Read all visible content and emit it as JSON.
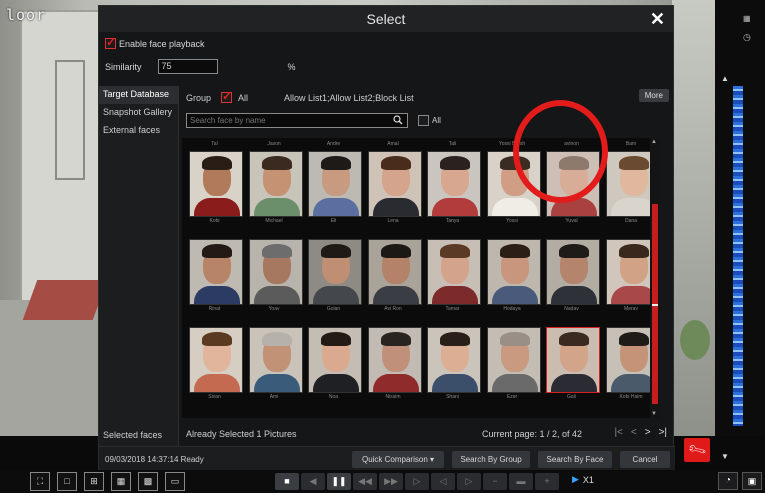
{
  "camera": {
    "label": "loor"
  },
  "dialog": {
    "title": "Select",
    "enable_face_playback": {
      "label": "Enable face playback",
      "checked": true
    },
    "similarity": {
      "label": "Similarity",
      "value": "75",
      "unit": "%"
    },
    "sidebar": {
      "items": [
        {
          "label": "Target Database",
          "active": true
        },
        {
          "label": "Snapshot Gallery",
          "active": false
        },
        {
          "label": "External faces",
          "active": false
        }
      ],
      "selected_faces": "Selected faces"
    },
    "group": {
      "label": "Group",
      "all_label": "All",
      "all_checked": true,
      "lists": "Allow List1;Allow List2;Block List",
      "more": "More"
    },
    "search": {
      "placeholder": "Search face by name",
      "all_label": "All"
    },
    "faces": [
      {
        "top": "Tal",
        "bottom": "Kobi",
        "skin": "#b17a5a",
        "hair": "#2a1d16",
        "body": "#8a1c1c",
        "bg": "#d9d2c9",
        "selected": false
      },
      {
        "top": "Jason",
        "bottom": "Michael",
        "skin": "#c59274",
        "hair": "#3a2a20",
        "body": "#6c8f6b",
        "bg": "#c8c4ba",
        "selected": false
      },
      {
        "top": "Andre",
        "bottom": "Eli",
        "skin": "#c89a80",
        "hair": "#1d1a18",
        "body": "#5a6fa0",
        "bg": "#bcbab3",
        "selected": false
      },
      {
        "top": "Amal",
        "bottom": "Lena",
        "skin": "#d4a48c",
        "hair": "#4a2c1c",
        "body": "#2a2b30",
        "bg": "#cfc3b8",
        "selected": false
      },
      {
        "top": "Tali",
        "bottom": "Tanya",
        "skin": "#d7a88f",
        "hair": "#2b2220",
        "body": "#b23b3b",
        "bg": "#cac6bf",
        "selected": false
      },
      {
        "top": "Yossi Brosh",
        "bottom": "Yossi",
        "skin": "#cf9e84",
        "hair": "#3a2c22",
        "body": "#f0ede6",
        "bg": "#d8d2c9",
        "selected": false
      },
      {
        "top": "avinon",
        "bottom": "Yuval",
        "skin": "#d7ad98",
        "hair": "#8d7a6c",
        "body": "#a94141",
        "bg": "#cdbfb6",
        "selected": false
      },
      {
        "top": "Bam",
        "bottom": "Dana",
        "skin": "#e0b89e",
        "hair": "#6a4a30",
        "body": "#d9d4cc",
        "bg": "#cfc8be",
        "selected": false
      },
      {
        "top": "",
        "bottom": "Rinat",
        "skin": "#b88468",
        "hair": "#241a15",
        "body": "#2c3b63",
        "bg": "#bfbab1",
        "selected": false
      },
      {
        "top": "",
        "bottom": "Yoav",
        "skin": "#a77860",
        "hair": "#6d6d6d",
        "body": "#5b5b5b",
        "bg": "#b9b4ab",
        "selected": false
      },
      {
        "top": "",
        "bottom": "Golan",
        "skin": "#c08e72",
        "hair": "#1f1a16",
        "body": "#44484c",
        "bg": "#8e8a84",
        "selected": false
      },
      {
        "top": "",
        "bottom": "Avi Ron",
        "skin": "#b48268",
        "hair": "#1c1816",
        "body": "#3b3d44",
        "bg": "#a9a39a",
        "selected": false
      },
      {
        "top": "",
        "bottom": "Tamar",
        "skin": "#d3a48b",
        "hair": "#5a3a24",
        "body": "#7c2a2a",
        "bg": "#c7bfb6",
        "selected": false
      },
      {
        "top": "",
        "bottom": "Hodaya",
        "skin": "#c8967c",
        "hair": "#2a1e16",
        "body": "#4a5a7a",
        "bg": "#bdb7ae",
        "selected": false
      },
      {
        "top": "",
        "bottom": "Nadav",
        "skin": "#b5846c",
        "hair": "#1e1b18",
        "body": "#2e3138",
        "bg": "#b2aca3",
        "selected": false
      },
      {
        "top": "",
        "bottom": "Merav",
        "skin": "#d2a287",
        "hair": "#3b281c",
        "body": "#a84848",
        "bg": "#d0c6bb",
        "selected": false
      },
      {
        "top": "",
        "bottom": "Sivan",
        "skin": "#e0b59b",
        "hair": "#5a3a20",
        "body": "#c46a50",
        "bg": "#d6cec3",
        "selected": false
      },
      {
        "top": "",
        "bottom": "Ami",
        "skin": "#c29276",
        "hair": "#b6b1ab",
        "body": "#3b5b7a",
        "bg": "#c9c3ba",
        "selected": false
      },
      {
        "top": "",
        "bottom": "Noa",
        "skin": "#d9aa8f",
        "hair": "#241a15",
        "body": "#1f2024",
        "bg": "#c4bdb4",
        "selected": false
      },
      {
        "top": "",
        "bottom": "Nissim",
        "skin": "#c0907a",
        "hair": "#2a2420",
        "body": "#8f2b2b",
        "bg": "#c1bbb3",
        "selected": false
      },
      {
        "top": "",
        "bottom": "Shani",
        "skin": "#dcae94",
        "hair": "#2a1e18",
        "body": "#3b4f6b",
        "bg": "#cbc4bb",
        "selected": false
      },
      {
        "top": "",
        "bottom": "Ezer",
        "skin": "#c99a80",
        "hair": "#9a8f86",
        "body": "#6a6a6a",
        "bg": "#c3bdb4",
        "selected": false
      },
      {
        "top": "",
        "bottom": "Gali",
        "skin": "#d2a489",
        "hair": "#3b2a20",
        "body": "#2b2c33",
        "bg": "#cbbcb1",
        "selected": true
      },
      {
        "top": "",
        "bottom": "Kobi Haim",
        "skin": "#c59378",
        "hair": "#1f1b18",
        "body": "#4b5a6b",
        "bg": "#c6c0b7",
        "selected": false
      }
    ],
    "footer": {
      "selected_count": "Already Selected 1 Pictures",
      "current_page": "Current page: 1 / 2, of 42",
      "pager": [
        "|<",
        "<",
        ">",
        ">|"
      ]
    },
    "status": "09/03/2018 14:37:14 Ready",
    "buttons": {
      "quick_comparison": "Quick Comparison",
      "search_by_group": "Search By Group",
      "search_by_face": "Search By Face",
      "cancel": "Cancel"
    }
  },
  "toolbar": {
    "speed": "X1"
  },
  "colors": {
    "accent_red": "#d42020",
    "timeline_blue": "#2d77e6"
  }
}
